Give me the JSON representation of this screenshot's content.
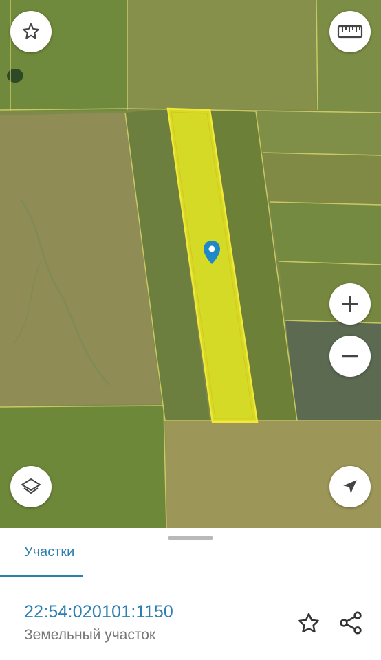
{
  "map": {
    "marker_color": "#1E88C8",
    "highlight_color": "#E6EC1E",
    "icons": {
      "favorite": "star-outline-icon",
      "ruler": "ruler-icon",
      "zoom_in": "plus-icon",
      "zoom_out": "minus-icon",
      "layers": "layers-icon",
      "location": "navigation-arrow-icon"
    }
  },
  "sheet": {
    "tabs": [
      {
        "label": "Участки",
        "active": true
      }
    ],
    "parcel": {
      "cadastral_number": "22:54:020101:1150",
      "type": "Земельный участок"
    },
    "actions": {
      "favorite_icon": "star-outline-icon",
      "share_icon": "share-icon"
    },
    "accent_color": "#2D7FB0"
  }
}
